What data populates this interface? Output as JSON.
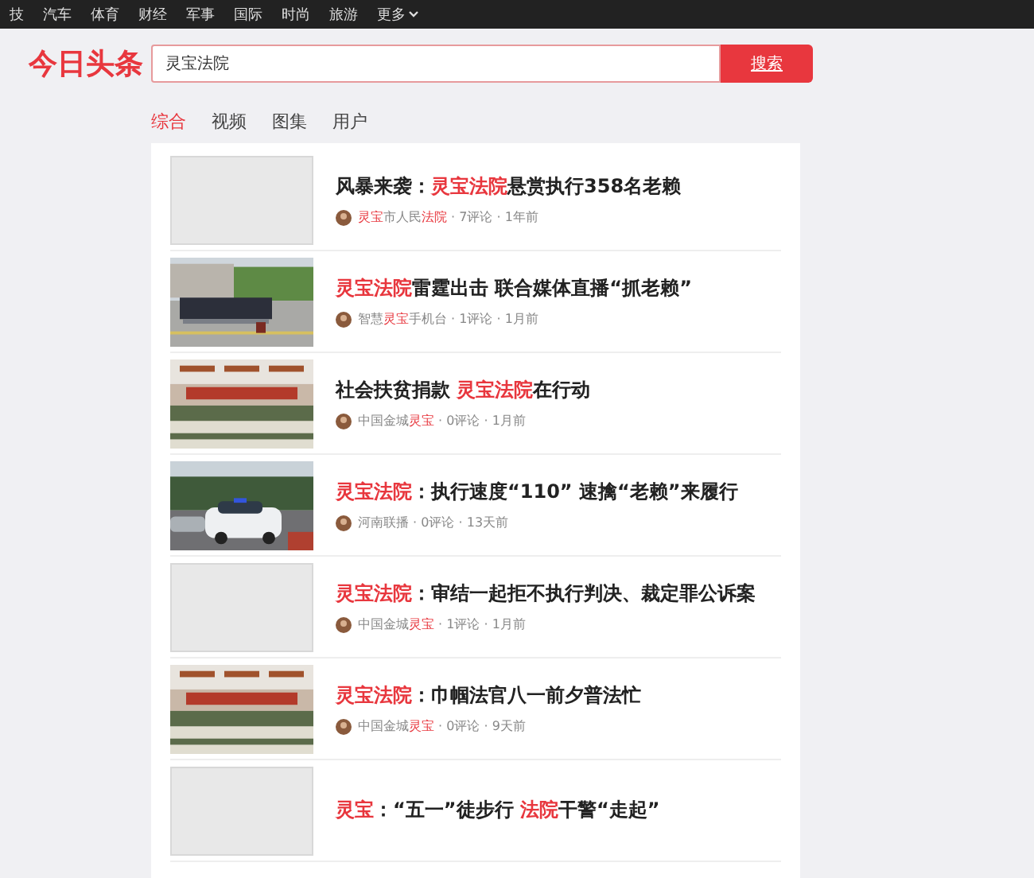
{
  "top_nav": [
    {
      "label": "技"
    },
    {
      "label": "汽车"
    },
    {
      "label": "体育"
    },
    {
      "label": "财经"
    },
    {
      "label": "军事"
    },
    {
      "label": "国际"
    },
    {
      "label": "时尚"
    },
    {
      "label": "旅游"
    },
    {
      "label": "更多",
      "dropdown": true
    }
  ],
  "logo": "今日头条",
  "search": {
    "value": "灵宝法院",
    "button": "搜索"
  },
  "tabs": [
    {
      "label": "综合",
      "selected": true
    },
    {
      "label": "视频",
      "selected": false
    },
    {
      "label": "图集",
      "selected": false
    },
    {
      "label": "用户",
      "selected": false
    }
  ],
  "results": [
    {
      "thumbnail": {
        "kind": "empty"
      },
      "title": [
        {
          "text": "风暴来袭：",
          "highlight": false
        },
        {
          "text": "灵宝法院",
          "highlight": true
        },
        {
          "text": "悬赏执行358名老赖",
          "highlight": false
        }
      ],
      "source": [
        {
          "text": "灵宝",
          "highlight": true
        },
        {
          "text": "市人民",
          "highlight": false
        },
        {
          "text": "法院",
          "highlight": true
        }
      ],
      "comments": "· 7评论",
      "time": "· 1年前"
    },
    {
      "thumbnail": {
        "kind": "picture"
      },
      "title": [
        {
          "text": "灵宝法院",
          "highlight": true
        },
        {
          "text": "雷霆出击 联合媒体直播“抓老赖”",
          "highlight": false
        }
      ],
      "source": [
        {
          "text": "智慧",
          "highlight": false
        },
        {
          "text": "灵宝",
          "highlight": true
        },
        {
          "text": "手机台",
          "highlight": false
        }
      ],
      "comments": "· 1评论",
      "time": "· 1月前"
    },
    {
      "thumbnail": {
        "kind": "picture"
      },
      "title": [
        {
          "text": "社会扶贫捐款 ",
          "highlight": false
        },
        {
          "text": "灵宝法院",
          "highlight": true
        },
        {
          "text": "在行动",
          "highlight": false
        }
      ],
      "source": [
        {
          "text": "中国金城",
          "highlight": false
        },
        {
          "text": "灵宝",
          "highlight": true
        }
      ],
      "comments": "· 0评论",
      "time": "· 1月前"
    },
    {
      "thumbnail": {
        "kind": "picture"
      },
      "title": [
        {
          "text": "灵宝法院",
          "highlight": true
        },
        {
          "text": "：执行速度“110” 速擒“老赖”来履行",
          "highlight": false
        }
      ],
      "source": [
        {
          "text": "河南联播",
          "highlight": false
        }
      ],
      "comments": "· 0评论",
      "time": "· 13天前"
    },
    {
      "thumbnail": {
        "kind": "empty"
      },
      "title": [
        {
          "text": "灵宝法院",
          "highlight": true
        },
        {
          "text": "：审结一起拒不执行判决、裁定罪公诉案",
          "highlight": false
        }
      ],
      "source": [
        {
          "text": "中国金城",
          "highlight": false
        },
        {
          "text": "灵宝",
          "highlight": true
        }
      ],
      "comments": "· 1评论",
      "time": "· 1月前"
    },
    {
      "thumbnail": {
        "kind": "picture"
      },
      "title": [
        {
          "text": "灵宝法院",
          "highlight": true
        },
        {
          "text": "：巾帼法官八一前夕普法忙",
          "highlight": false
        }
      ],
      "source": [
        {
          "text": "中国金城",
          "highlight": false
        },
        {
          "text": "灵宝",
          "highlight": true
        }
      ],
      "comments": "· 0评论",
      "time": "· 9天前"
    },
    {
      "thumbnail": {
        "kind": "empty"
      },
      "title": [
        {
          "text": "灵宝",
          "highlight": true
        },
        {
          "text": "：“五一”徒步行 ",
          "highlight": false
        },
        {
          "text": "法院",
          "highlight": true
        },
        {
          "text": "干警“走起”",
          "highlight": false
        }
      ]
    }
  ]
}
